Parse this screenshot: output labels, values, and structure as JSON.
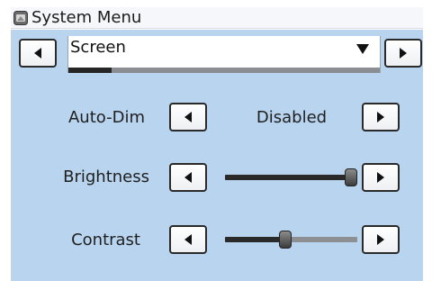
{
  "window": {
    "title": "System Menu",
    "icon": "system-menu-icon"
  },
  "menu": {
    "selected": "Screen",
    "scroll_position": 0.14
  },
  "settings": [
    {
      "label": "Auto-Dim",
      "kind": "value",
      "value": "Disabled"
    },
    {
      "label": "Brightness",
      "kind": "slider",
      "level": 1.0
    },
    {
      "label": "Contrast",
      "kind": "slider",
      "level": 0.45
    }
  ],
  "colors": {
    "panel": "#b8d4ef",
    "slider_fill": "#2a2a2a",
    "slider_track": "#8d8f92"
  }
}
